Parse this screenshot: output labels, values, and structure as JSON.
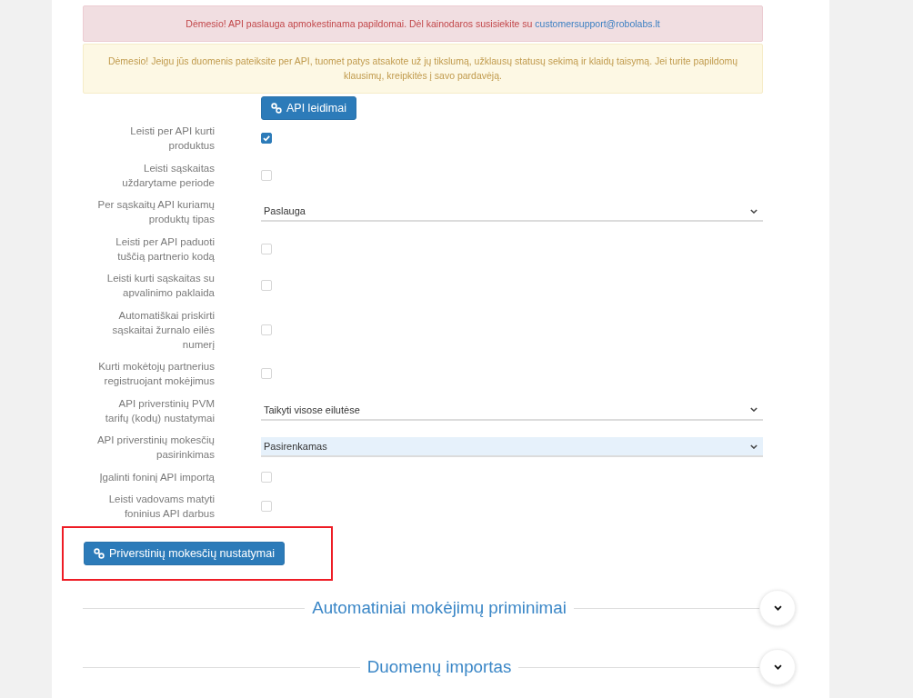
{
  "alerts": [
    {
      "kind": "danger",
      "text": "Dėmesio! API paslauga apmokestinama papildomai. Dėl kainodaros susisiekite su",
      "link": "customersupport@robolabs.lt"
    },
    {
      "kind": "warning",
      "text": "Dėmesio! Jeigu jūs duomenis pateiksite per API, tuomet patys atsakote už jų tikslumą, užklausų statusų sekimą ir klaidų taisymą. Jei turite papildomų klausimų, kreipkitės į savo pardavėją."
    }
  ],
  "permissions_button": {
    "label": "API leidimai"
  },
  "settings": [
    {
      "kind": "checkbox",
      "label": "Leisti per API kurti produktus",
      "checked": true
    },
    {
      "kind": "checkbox",
      "label": "Leisti sąskaitas uždarytame periode",
      "checked": false
    },
    {
      "kind": "select",
      "label": "Per sąskaitų API kuriamų produktų tipas",
      "value": "Paslauga",
      "highlighted": false
    },
    {
      "kind": "checkbox",
      "label": "Leisti per API paduoti tuščią partnerio kodą",
      "checked": false
    },
    {
      "kind": "checkbox",
      "label": "Leisti kurti sąskaitas su apvalinimo paklaida",
      "checked": false
    },
    {
      "kind": "checkbox",
      "label": "Automatiškai priskirti sąskaitai žurnalo eilės numerį",
      "checked": false
    },
    {
      "kind": "checkbox",
      "label": "Kurti mokėtojų partnerius registruojant mokėjimus",
      "checked": false
    },
    {
      "kind": "select",
      "label": "API priverstinių PVM tarifų (kodų) nustatymai",
      "value": "Taikyti visose eilutėse",
      "highlighted": false
    },
    {
      "kind": "select",
      "label": "API priverstinių mokesčių pasirinkimas",
      "value": "Pasirenkamas",
      "highlighted": true
    },
    {
      "kind": "checkbox",
      "label": "Įgalinti foninį API importą",
      "checked": false
    },
    {
      "kind": "checkbox",
      "label": "Leisti vadovams matyti foninius API darbus",
      "checked": false
    }
  ],
  "tax_settings_button": {
    "label": "Priverstinių mokesčių nustatymai",
    "highlighted": true
  },
  "sections": [
    {
      "title": "Automatiniai mokėjimų priminimai",
      "expanded": false
    },
    {
      "title": "Duomenų importas",
      "expanded": false
    }
  ]
}
